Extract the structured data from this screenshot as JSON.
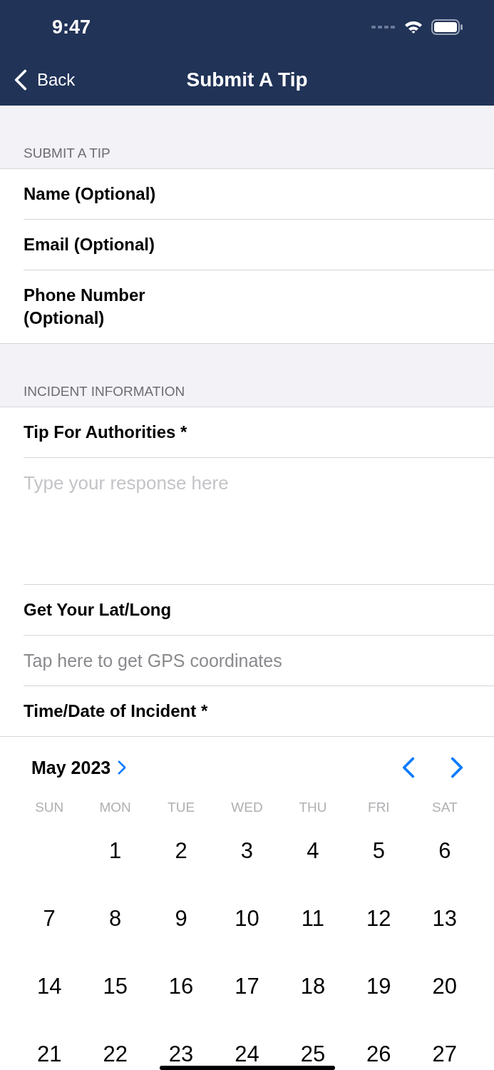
{
  "status_bar": {
    "time": "9:47"
  },
  "nav_bar": {
    "back_label": "Back",
    "title": "Submit A Tip"
  },
  "sections": [
    {
      "header": "SUBMIT A TIP",
      "rows": [
        {
          "kind": "field",
          "label": "Name (Optional)"
        },
        {
          "kind": "field",
          "label": "Email (Optional)"
        },
        {
          "kind": "field",
          "label": "Phone Number (Optional)"
        }
      ]
    },
    {
      "header": "INCIDENT INFORMATION",
      "rows": [
        {
          "kind": "field",
          "label": "Tip For Authorities *"
        },
        {
          "kind": "textarea",
          "placeholder": "Type your response here"
        },
        {
          "kind": "field",
          "label": "Get Your Lat/Long"
        },
        {
          "kind": "action",
          "label": "Tap here to get GPS coordinates"
        },
        {
          "kind": "field",
          "label": "Time/Date of Incident *"
        }
      ]
    }
  ],
  "calendar": {
    "month_label": "May 2023",
    "weekdays": [
      "SUN",
      "MON",
      "TUE",
      "WED",
      "THU",
      "FRI",
      "SAT"
    ],
    "weeks": [
      [
        "1",
        "2",
        "3",
        "4",
        "5",
        "6"
      ],
      [
        "7",
        "8",
        "9",
        "10",
        "11",
        "12",
        "13"
      ],
      [
        "14",
        "15",
        "16",
        "17",
        "18",
        "19",
        "20"
      ],
      [
        "21",
        "22",
        "23",
        "24",
        "25",
        "26",
        "27"
      ]
    ]
  }
}
